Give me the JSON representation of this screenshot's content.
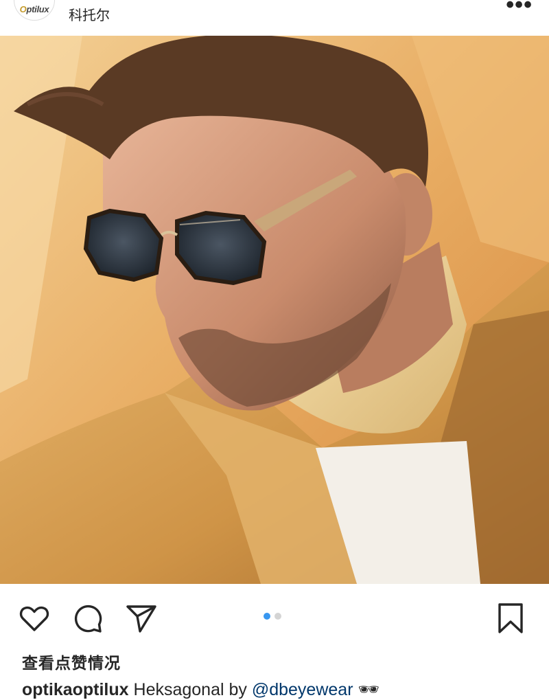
{
  "header": {
    "avatar_logo_prefix": "O",
    "avatar_logo_text": "ptilux",
    "location": "科托尔",
    "more_icon": "more-horizontal-icon"
  },
  "photo": {
    "subject": "man-in-sunglasses",
    "colors": {
      "background": "#e8b16a",
      "coat": "#d39a4c",
      "turtleneck": "#efd59c",
      "skin": "#d49a7c",
      "hair": "#5a3a24",
      "lens": "#2c3540"
    }
  },
  "actions": {
    "like_icon": "heart-icon",
    "comment_icon": "comment-icon",
    "share_icon": "send-icon",
    "save_icon": "bookmark-icon",
    "carousel": {
      "current": 1,
      "total": 2
    },
    "accent_color": "#3897f0"
  },
  "likes_text": "查看点赞情况",
  "caption": {
    "username": "optikaoptilux",
    "text": " Heksagonal by ",
    "mention": "@dbeyewear",
    "emoji": " 🕶"
  }
}
